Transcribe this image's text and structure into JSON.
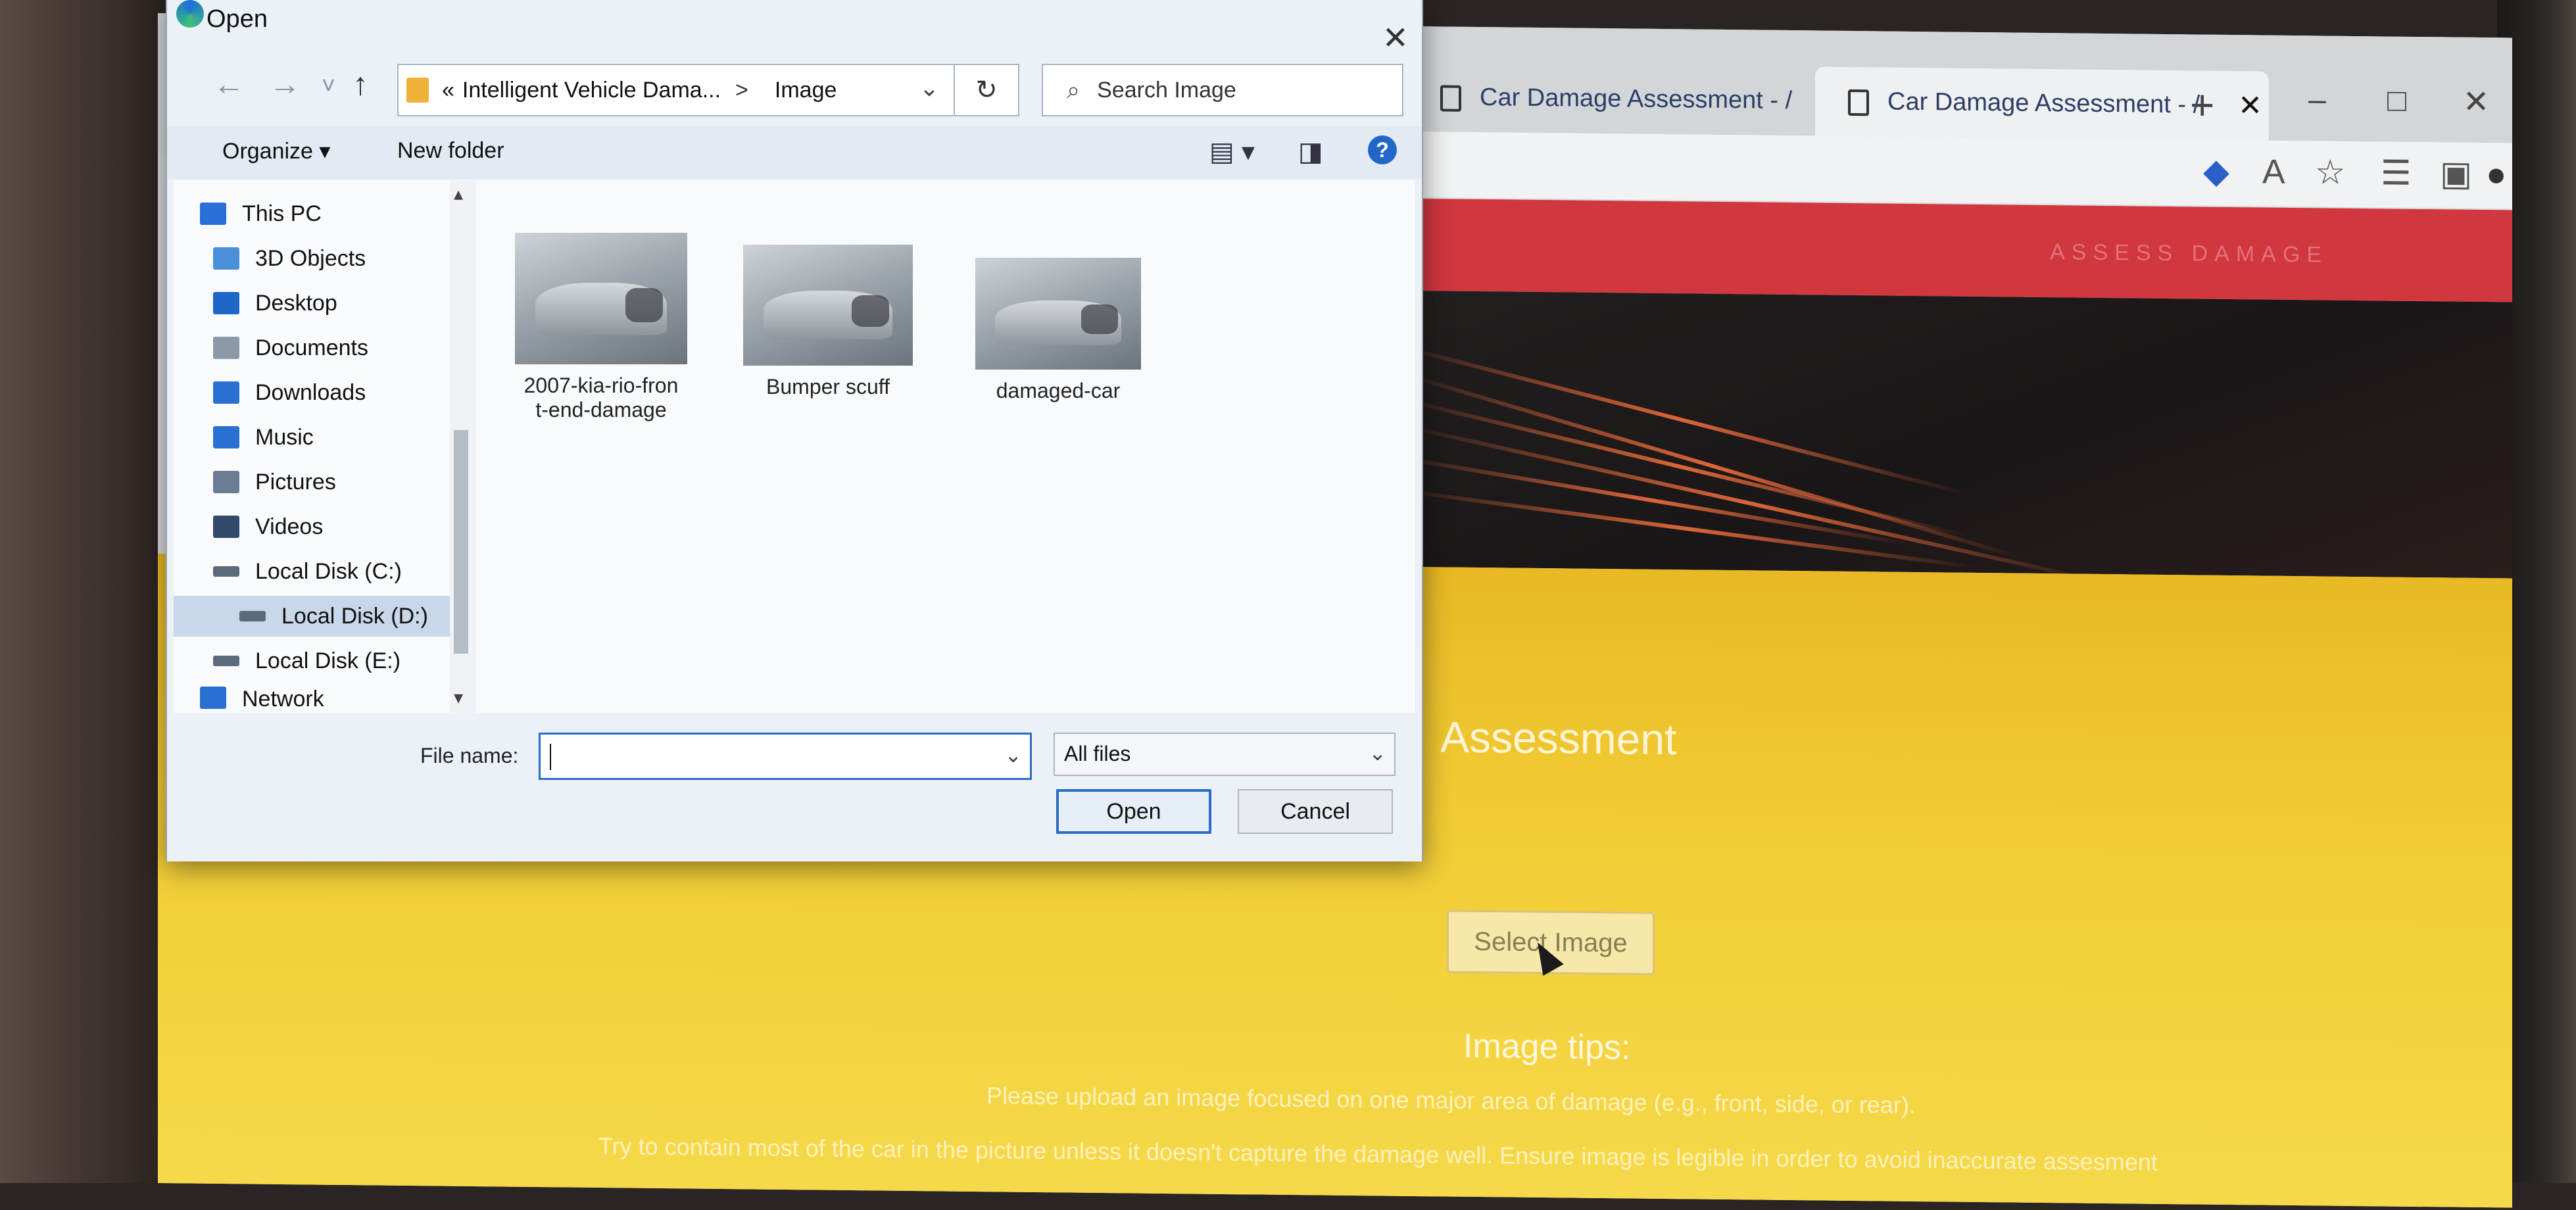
{
  "browser": {
    "tabs": [
      {
        "label": "Car Damage Assessment - /"
      },
      {
        "label": "Car Damage Assessment - /"
      }
    ],
    "new_tab_glyph": "+",
    "window_controls": {
      "minimize": "–",
      "maximize": "□",
      "close": "✕"
    },
    "toolbar_icons": [
      "tag-icon",
      "read-aloud-icon",
      "favorite-add-icon",
      "favorites-icon",
      "collections-icon",
      "profile-icon",
      "more-icon"
    ]
  },
  "page": {
    "nav_link": "ASSESS DAMAGE",
    "hero_title_fragment": "Assessment",
    "select_button": "Select Image",
    "tips_title": "Image tips:",
    "tip_1": "Please upload an image focused on one major area of damage (e.g., front, side, or rear).",
    "tip_2": "Try to contain most of the car in the picture unless it doesn't capture the damage well. Ensure image is legible in order to avoid inaccurate assesment"
  },
  "dialog": {
    "title": "Open",
    "close_glyph": "✕",
    "back_glyph": "←",
    "forward_glyph": "→",
    "recent_glyph": "˅",
    "up_glyph": "↑",
    "breadcrumb": {
      "prefix": "«",
      "parent": "Intelligent Vehicle Dama...",
      "separator": ">",
      "current": "Image"
    },
    "refresh_glyph": "↻",
    "search_placeholder": "Search Image",
    "organize_label": "Organize",
    "new_folder_label": "New folder",
    "help_glyph": "?",
    "nav_items": [
      {
        "label": "This PC",
        "icon": "pc-icon",
        "color": "#2a6fd6"
      },
      {
        "label": "3D Objects",
        "icon": "cube-icon",
        "color": "#4a8fd8"
      },
      {
        "label": "Desktop",
        "icon": "desktop-icon",
        "color": "#1f66c9"
      },
      {
        "label": "Documents",
        "icon": "documents-icon",
        "color": "#8e99a8"
      },
      {
        "label": "Downloads",
        "icon": "downloads-icon",
        "color": "#2a70d0"
      },
      {
        "label": "Music",
        "icon": "music-icon",
        "color": "#2a70d0"
      },
      {
        "label": "Pictures",
        "icon": "pictures-icon",
        "color": "#6a7d94"
      },
      {
        "label": "Videos",
        "icon": "videos-icon",
        "color": "#324a6a"
      },
      {
        "label": "Local Disk (C:)",
        "icon": "disk-icon",
        "color": "#5b6b7c"
      },
      {
        "label": "Local Disk (D:)",
        "icon": "disk-icon",
        "color": "#5b6b7c"
      },
      {
        "label": "Local Disk (E:)",
        "icon": "disk-icon",
        "color": "#5b6b7c"
      },
      {
        "label": "Network",
        "icon": "network-icon",
        "color": "#2a70d0"
      }
    ],
    "selected_nav": "Local Disk (D:)",
    "files": [
      {
        "name_line1": "2007-kia-rio-fron",
        "name_line2": "t-end-damage"
      },
      {
        "name_line1": "Bumper scuff",
        "name_line2": ""
      },
      {
        "name_line1": "damaged-car",
        "name_line2": ""
      }
    ],
    "file_name_label": "File name:",
    "file_name_value": "",
    "file_type_value": "All files",
    "open_button": "Open",
    "cancel_button": "Cancel"
  },
  "colors": {
    "page_red": "#d1373f",
    "page_yellow": "#f1cc34",
    "accent_blue": "#2b6cc4"
  }
}
